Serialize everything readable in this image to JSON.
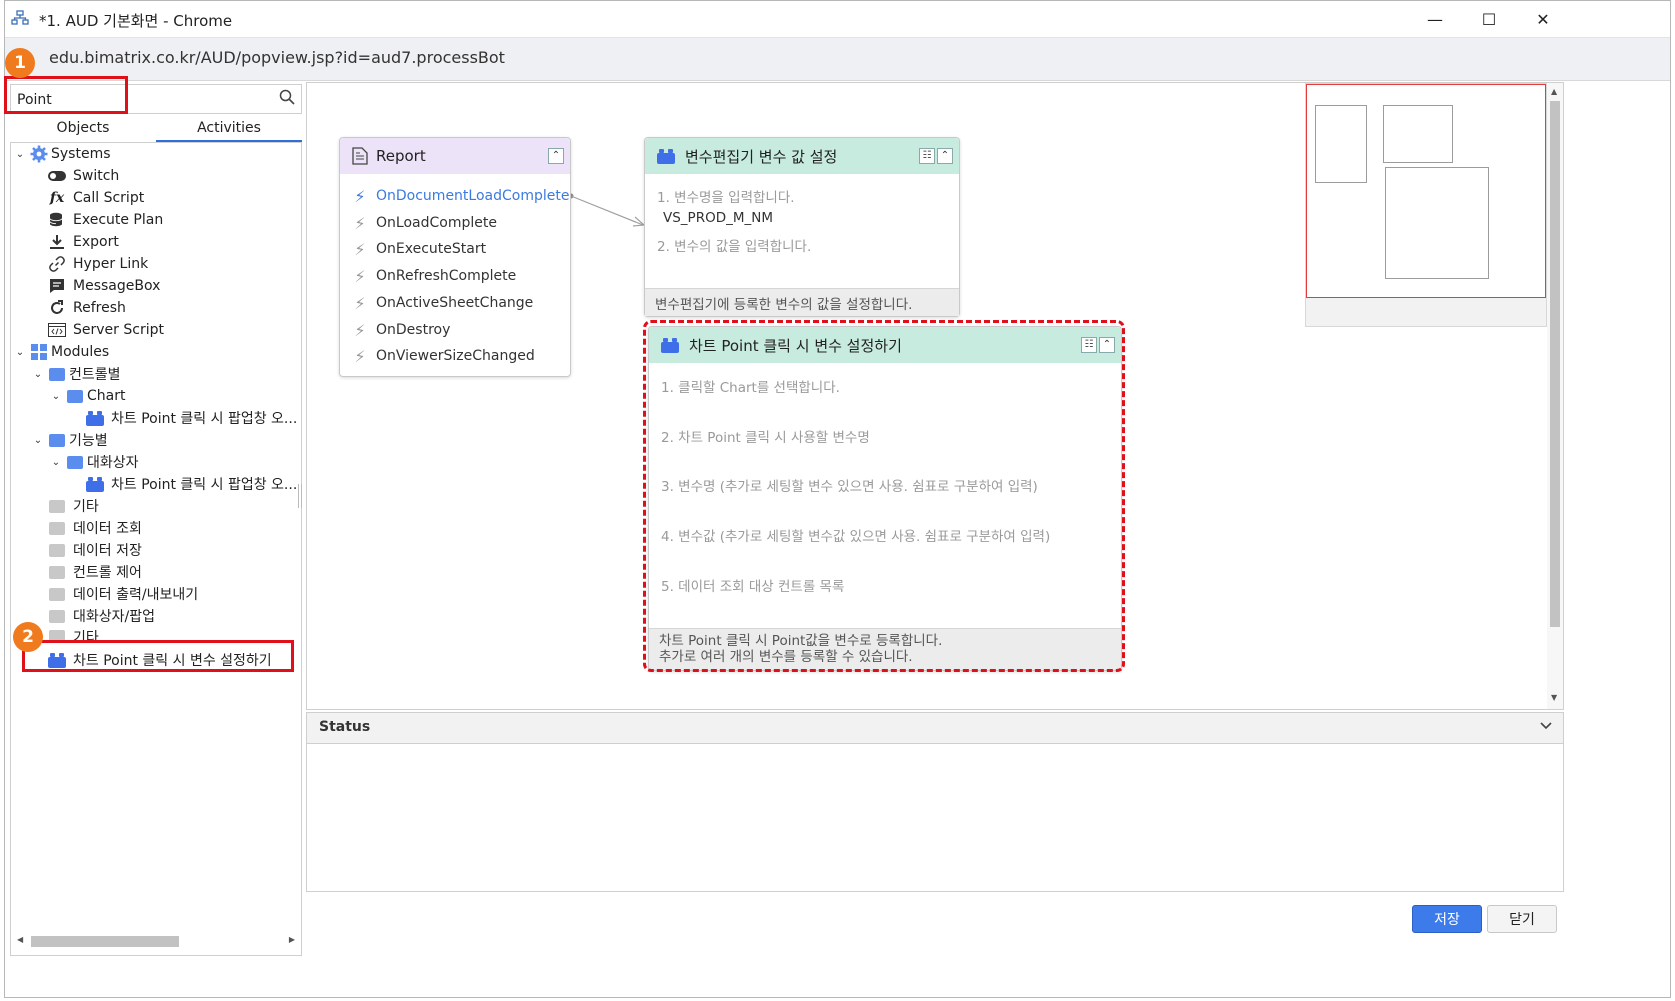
{
  "window": {
    "title": "*1. AUD 기본화면 - Chrome",
    "url": "edu.bimatrix.co.kr/AUD/popview.jsp?id=aud7.processBot",
    "minimize": "—",
    "maximize": "☐",
    "close": "✕"
  },
  "search": {
    "value": "Point"
  },
  "tabs": {
    "objects": "Objects",
    "activities": "Activities"
  },
  "tree": {
    "systems": "Systems",
    "switch": "Switch",
    "call_script": "Call Script",
    "execute_plan": "Execute Plan",
    "export": "Export",
    "hyper_link": "Hyper Link",
    "message_box": "MessageBox",
    "refresh": "Refresh",
    "server_script": "Server Script",
    "modules": "Modules",
    "control_by": "컨트롤별",
    "chart": "Chart",
    "chart_popup_1": "차트 Point 클릭 시 팝업창 오...",
    "function_by": "기능별",
    "dialog": "대화상자",
    "chart_popup_2": "차트 Point 클릭 시 팝업창 오...",
    "etc": "기타",
    "data_query": "데이터 조회",
    "data_save": "데이터 저장",
    "control_ctrl": "컨트롤 제어",
    "data_export": "데이터 출력/내보내기",
    "dialog_popup": "대화상자/팝업",
    "etc2": "기타",
    "selected_item": "차트 Point 클릭 시 변수 설정하기"
  },
  "report_node": {
    "title": "Report",
    "events": [
      "OnDocumentLoadComplete",
      "OnLoadComplete",
      "OnExecuteStart",
      "OnRefreshComplete",
      "OnActiveSheetChange",
      "OnDestroy",
      "OnViewerSizeChanged"
    ]
  },
  "var_node": {
    "title": "변수편집기 변수 값 설정",
    "param1": "1. 변수명을 입력합니다.",
    "value1": "VS_PROD_M_NM",
    "param2": "2. 변수의 값을 입력합니다.",
    "footer": "변수편집기에 등록한 변수의 값을 설정합니다."
  },
  "chart_node": {
    "title": "차트 Point 클릭 시 변수 설정하기",
    "params": [
      "1. 클릭할 Chart를 선택합니다.",
      "2. 차트 Point 클릭 시 사용할 변수명",
      "3. 변수명 (추가로 세팅할 변수 있으면 사용. 쉼표로 구분하여 입력)",
      "4. 변수값 (추가로 세팅할 변수값 있으면 사용. 쉼표로 구분하여 입력)",
      "5. 데이터 조회 대상 컨트롤 목록"
    ],
    "footer_line1": "차트 Point 클릭 시 Point값을 변수로 등록합니다.",
    "footer_line2": "추가로  여러 개의 변수를 등록할 수 있습니다."
  },
  "status": {
    "title": "Status"
  },
  "buttons": {
    "save": "저장",
    "close": "닫기"
  },
  "callouts": {
    "one": "1",
    "two": "2"
  },
  "colors": {
    "accent": "#3d7bea",
    "annotation_red": "#e0101a",
    "callout_orange": "#f07a1e",
    "report_header": "#ece3f8",
    "module_header": "#c8ebdf"
  }
}
